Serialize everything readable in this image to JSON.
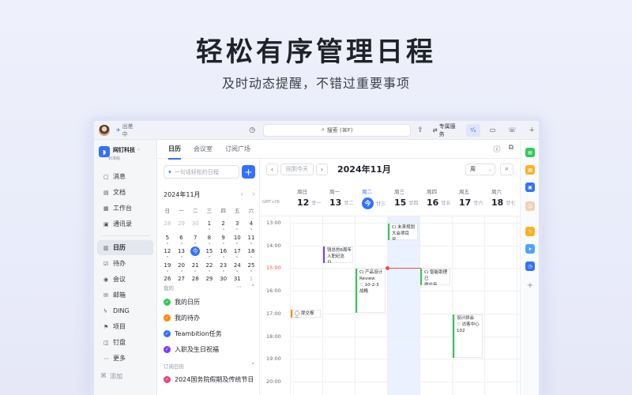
{
  "hero": {
    "title": "轻松有序管理日程",
    "subtitle": "及时动态提醒，不错过重要事项"
  },
  "topbar": {
    "status": "出差中",
    "search": "搜索 (⌘F)",
    "service": "专属服务"
  },
  "org": {
    "name": "网钉科技",
    "tag": "标准版"
  },
  "sidebar": {
    "items": [
      {
        "label": "消息",
        "icon": "message-icon",
        "glyph": "▢"
      },
      {
        "label": "文档",
        "icon": "doc-icon",
        "glyph": "▤"
      },
      {
        "label": "工作台",
        "icon": "workbench-icon",
        "glyph": "▦"
      },
      {
        "label": "通讯录",
        "icon": "contacts-icon",
        "glyph": "▣"
      },
      {
        "label": "日历",
        "icon": "calendar-icon",
        "glyph": "▥",
        "active": true
      },
      {
        "label": "待办",
        "icon": "todo-icon",
        "glyph": "☑"
      },
      {
        "label": "会议",
        "icon": "meeting-icon",
        "glyph": "◉"
      },
      {
        "label": "邮箱",
        "icon": "mail-icon",
        "glyph": "✉"
      },
      {
        "label": "DING",
        "icon": "ding-icon",
        "glyph": "ϟ"
      },
      {
        "label": "项目",
        "icon": "project-icon",
        "glyph": "⚑"
      },
      {
        "label": "钉盘",
        "icon": "drive-icon",
        "glyph": "◫"
      },
      {
        "label": "更多",
        "icon": "more-icon",
        "glyph": "⋯"
      }
    ],
    "add": "添加"
  },
  "tabs": [
    "日历",
    "会议室",
    "订阅广场"
  ],
  "left": {
    "create_placeholder": "一句话轻松约日程",
    "mini_month": "2024年11月",
    "weekdays": [
      "日",
      "一",
      "二",
      "三",
      "四",
      "五",
      "六"
    ],
    "weeks": [
      [
        [
          "28",
          0
        ],
        [
          "29",
          0
        ],
        [
          "30",
          0
        ],
        [
          "1",
          1
        ],
        [
          "2",
          1
        ],
        [
          "3",
          1
        ],
        [
          "4",
          1
        ]
      ],
      [
        [
          "5",
          1
        ],
        [
          "6",
          1
        ],
        [
          "7",
          1
        ],
        [
          "8",
          1
        ],
        [
          "9",
          1
        ],
        [
          "10",
          1
        ],
        [
          "11",
          1
        ]
      ],
      [
        [
          "12",
          1
        ],
        [
          "13",
          1
        ],
        [
          "今",
          2
        ],
        [
          "15",
          1
        ],
        [
          "16",
          1
        ],
        [
          "17",
          1
        ],
        [
          "18",
          1
        ]
      ],
      [
        [
          "19",
          1
        ],
        [
          "20",
          1
        ],
        [
          "21",
          1
        ],
        [
          "22",
          1
        ],
        [
          "23",
          1
        ],
        [
          "24",
          1
        ],
        [
          "25",
          1
        ]
      ],
      [
        [
          "26",
          1
        ],
        [
          "27",
          1
        ],
        [
          "28",
          1
        ],
        [
          "29",
          1
        ],
        [
          "30",
          1
        ],
        [
          "31",
          1
        ],
        [
          "1",
          0
        ]
      ]
    ],
    "my_section": "我的",
    "my_calendars": [
      {
        "label": "我的日历",
        "color": "#34c759"
      },
      {
        "label": "我的待办",
        "color": "#ff8800"
      },
      {
        "label": "Teambition任务",
        "color": "#3370ff"
      },
      {
        "label": "入职及生日祝福",
        "color": "#7f3bf5"
      }
    ],
    "sub_section": "订阅日历",
    "sub_calendars": [
      {
        "label": "2024国务院假期及传统节日",
        "color": "#e8467c"
      }
    ]
  },
  "week": {
    "today_btn": "回到今天",
    "title": "2024年11月",
    "view": "周",
    "gmt": "GMT+08",
    "days": [
      {
        "w": "周日",
        "d": "12",
        "l": "廿一"
      },
      {
        "w": "周一",
        "d": "13",
        "l": "廿二"
      },
      {
        "w": "周二",
        "d": "今",
        "l": "廿三",
        "today": true
      },
      {
        "w": "周三",
        "d": "15",
        "l": "廿四"
      },
      {
        "w": "周四",
        "d": "16",
        "l": "廿五"
      },
      {
        "w": "周五",
        "d": "17",
        "l": "廿六"
      },
      {
        "w": "周六",
        "d": "18",
        "l": "廿七"
      }
    ],
    "hours": [
      "13:00",
      "14:00",
      "15:00",
      "16:00",
      "17:00",
      "18:00",
      "19:00",
      "20:00"
    ],
    "now_label": "15:00",
    "events": [
      {
        "day": 3,
        "start": 13.0,
        "end": 13.8,
        "lines": [
          "Ci 未来规划",
          "大会项目安..."
        ],
        "color": "green"
      },
      {
        "day": 1,
        "start": 14.0,
        "end": 14.8,
        "lines": [
          "钱总的6周年",
          "入职纪念日..."
        ],
        "color": "purple"
      },
      {
        "day": 2,
        "start": 15.0,
        "end": 17.0,
        "lines": [
          "Ci 产品设计",
          "Review",
          "♡ 10-2-3 战略"
        ],
        "color": "green"
      },
      {
        "day": 4,
        "start": 15.0,
        "end": 15.8,
        "lines": [
          "Ci 智能助理已",
          "提交至review"
        ],
        "color": "green"
      },
      {
        "day": 0,
        "start": 16.8,
        "end": 17.2,
        "lines": [
          "◯ 提交报销..."
        ],
        "color": "orange"
      },
      {
        "day": 5,
        "start": 17.0,
        "end": 19.0,
        "lines": [
          "设计拼会",
          "♡ 访客中心102"
        ],
        "color": "green"
      }
    ]
  }
}
